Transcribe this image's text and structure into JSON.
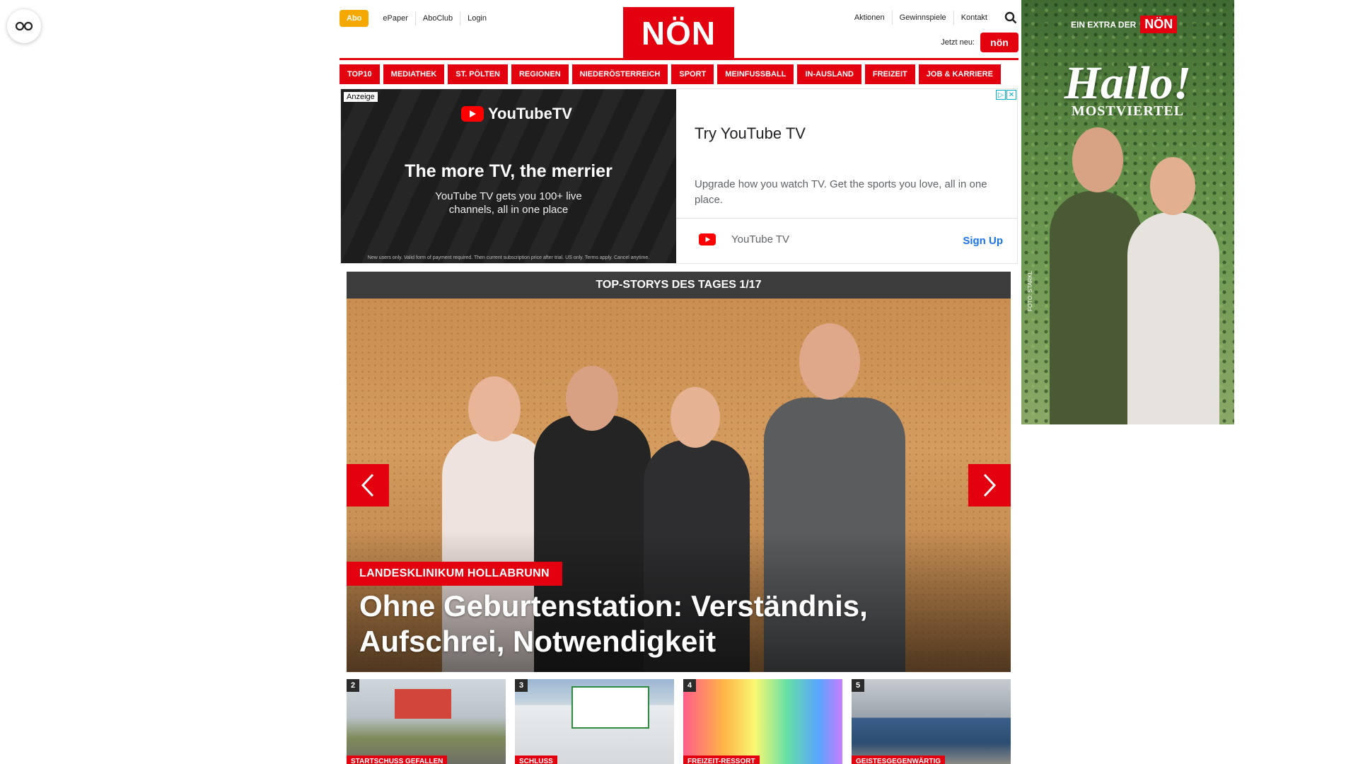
{
  "header": {
    "abo_label": "Abo",
    "left_links": [
      "ePaper",
      "AboClub",
      "Login"
    ],
    "logo_text": "NÖN",
    "right_links": [
      "Aktionen",
      "Gewinnspiele",
      "Kontakt"
    ],
    "jetzt_label": "Jetzt neu:",
    "badge_text": "nön"
  },
  "nav": {
    "categories": [
      "TOP10",
      "MEDIATHEK",
      "ST. PÖLTEN",
      "REGIONEN",
      "NIEDERÖSTERREICH",
      "SPORT",
      "MEINFUSSBALL",
      "IN-AUSLAND",
      "FREIZEIT",
      "JOB & KARRIERE"
    ]
  },
  "ad": {
    "anzeige_label": "Anzeige",
    "brand_logo_text": "YouTubeTV",
    "headline": "The more TV, the merrier",
    "subtext": "YouTube TV gets you 100+ live channels, all in one place",
    "fine_print": "New users only. Valid form of payment required. Then current subscription price after trial. US only. Terms apply. Cancel anytime.",
    "title": "Try YouTube TV",
    "description": "Upgrade how you watch TV. Get the sports you love, all in one place.",
    "advertiser": "YouTube TV",
    "cta": "Sign Up",
    "colors": {
      "youtube_red": "#ff0000",
      "cta_blue": "#1a73e8"
    }
  },
  "top_stories": {
    "header": "TOP-STORYS DES TAGES 1/17",
    "hero": {
      "category": "LANDESKLINIKUM HOLLABRUNN",
      "title": "Ohne Geburtenstation: Verständnis, Aufschrei, Notwendigkeit"
    },
    "thumbs": [
      {
        "num": "2",
        "category": "STARTSCHUSS GEFALLEN"
      },
      {
        "num": "3",
        "category": "SCHLUSS"
      },
      {
        "num": "4",
        "category": "FREIZEIT-RESSORT"
      },
      {
        "num": "5",
        "category": "GEISTESGEGENWÄRTIG"
      }
    ]
  },
  "promo": {
    "extra_label": "EIN EXTRA DER",
    "non_label": "NÖN",
    "hallo": "Hallo!",
    "region": "MOSTVIERTEL",
    "credit": "FOTO: STARKL"
  },
  "colors": {
    "brand_red": "#e3000f",
    "abo_orange": "#f5a800"
  }
}
